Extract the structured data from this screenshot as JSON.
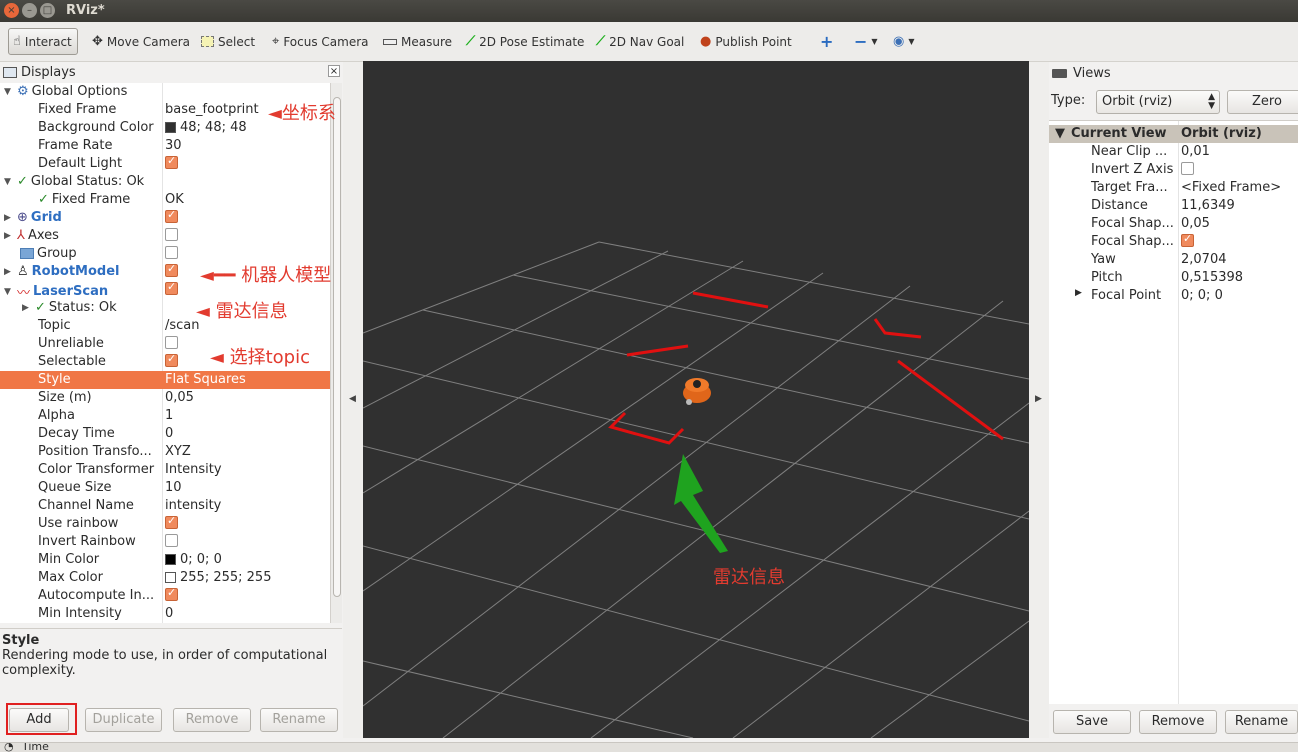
{
  "window": {
    "title": "RViz*",
    "close_glyph": "×",
    "min_glyph": "–",
    "max_glyph": "□"
  },
  "toolbar": {
    "interact": "Interact",
    "move_camera": "Move Camera",
    "select": "Select",
    "focus_camera": "Focus Camera",
    "measure": "Measure",
    "pose_estimate": "2D Pose Estimate",
    "nav_goal": "2D Nav Goal",
    "publish_point": "Publish Point",
    "icons": [
      "hand-pointer-icon",
      "move-arrows-icon",
      "select-box-icon",
      "crosshair-icon",
      "ruler-icon",
      "green-arrow-icon",
      "green-arrow-icon",
      "map-pin-icon",
      "plus-icon",
      "minus-icon",
      "eye-icon"
    ]
  },
  "displays": {
    "title": "Displays",
    "close_glyph": "×",
    "rows": [
      {
        "label": "Global Options",
        "value": ""
      },
      {
        "label": "Fixed Frame",
        "value": "base_footprint"
      },
      {
        "label": "Background Color",
        "value": "48; 48; 48"
      },
      {
        "label": "Frame Rate",
        "value": "30"
      },
      {
        "label": "Default Light",
        "value": ""
      },
      {
        "label": "Global Status: Ok",
        "value": ""
      },
      {
        "label": "Fixed Frame",
        "value": "OK"
      },
      {
        "label": "Grid",
        "value": ""
      },
      {
        "label": "Axes",
        "value": ""
      },
      {
        "label": "Group",
        "value": ""
      },
      {
        "label": "RobotModel",
        "value": ""
      },
      {
        "label": "LaserScan",
        "value": ""
      },
      {
        "label": "Status: Ok",
        "value": ""
      },
      {
        "label": "Topic",
        "value": "/scan"
      },
      {
        "label": "Unreliable",
        "value": ""
      },
      {
        "label": "Selectable",
        "value": ""
      },
      {
        "label": "Style",
        "value": "Flat Squares"
      },
      {
        "label": "Size (m)",
        "value": "0,05"
      },
      {
        "label": "Alpha",
        "value": "1"
      },
      {
        "label": "Decay Time",
        "value": "0"
      },
      {
        "label": "Position Transfo...",
        "value": "XYZ"
      },
      {
        "label": "Color Transformer",
        "value": "Intensity"
      },
      {
        "label": "Queue Size",
        "value": "10"
      },
      {
        "label": "Channel Name",
        "value": "intensity"
      },
      {
        "label": "Use rainbow",
        "value": ""
      },
      {
        "label": "Invert Rainbow",
        "value": ""
      },
      {
        "label": "Min Color",
        "value": "0; 0; 0"
      },
      {
        "label": "Max Color",
        "value": "255; 255; 255"
      },
      {
        "label": "Autocompute In...",
        "value": ""
      },
      {
        "label": "Min Intensity",
        "value": "0"
      }
    ],
    "colors": {
      "background_swatch": "#303030",
      "min_swatch": "#000000",
      "max_swatch": "#ffffff",
      "selection": "#f07746"
    },
    "description_title": "Style",
    "description_text": "Rendering mode to use, in order of computational complexity.",
    "buttons": {
      "add": "Add",
      "duplicate": "Duplicate",
      "remove": "Remove",
      "rename": "Rename"
    }
  },
  "annotations": {
    "frame": "坐标系",
    "robot_model": "机器人模型",
    "laser": "雷达信息",
    "topic": "选择topic",
    "scan_info": "雷达信息"
  },
  "views": {
    "title": "Views",
    "type_label": "Type:",
    "type_value": "Orbit (rviz)",
    "zero": "Zero",
    "header_name": "Current View",
    "header_value": "Orbit (rviz)",
    "rows": [
      {
        "label": "Near Clip ...",
        "value": "0,01"
      },
      {
        "label": "Invert Z Axis",
        "value": ""
      },
      {
        "label": "Target Fra...",
        "value": "<Fixed Frame>"
      },
      {
        "label": "Distance",
        "value": "11,6349"
      },
      {
        "label": "Focal Shap...",
        "value": "0,05"
      },
      {
        "label": "Focal Shap...",
        "value": ""
      },
      {
        "label": "Yaw",
        "value": "2,0704"
      },
      {
        "label": "Pitch",
        "value": "0,515398"
      },
      {
        "label": "Focal Point",
        "value": "0; 0; 0"
      }
    ],
    "buttons": {
      "save": "Save",
      "remove": "Remove",
      "rename": "Rename"
    }
  },
  "timebar": {
    "label": "Time"
  },
  "render_colors": {
    "background": "#303030",
    "grid": "#a0a0a0",
    "laser": "#e01010",
    "robot": "#e0661a",
    "arrow": "#1fa31f"
  }
}
